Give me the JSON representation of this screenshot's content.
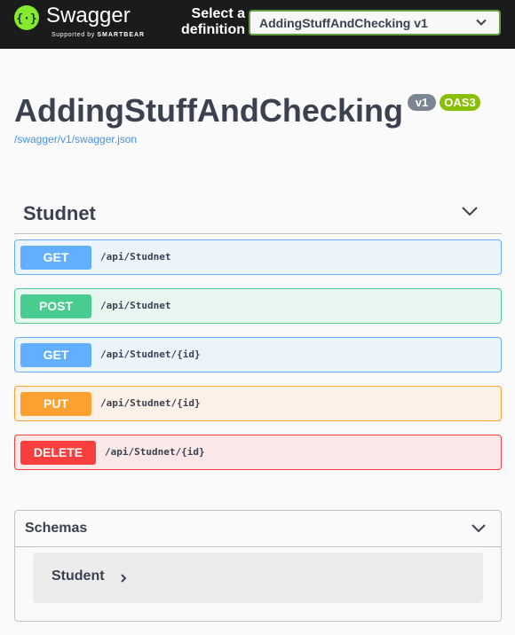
{
  "topbar": {
    "brand": "Swagger",
    "brand_sub_prefix": "Supported by",
    "brand_sub_company": "SMARTBEAR",
    "select_label": "Select a definition",
    "selected_definition": "AddingStuffAndChecking v1",
    "logo_icon": "swagger-logo-icon",
    "chevron_icon": "chevron-down-icon"
  },
  "info": {
    "title": "AddingStuffAndChecking",
    "version": "v1",
    "oas": "OAS3",
    "spec_url": "/swagger/v1/swagger.json"
  },
  "tag": {
    "name": "Studnet",
    "operations": [
      {
        "method": "GET",
        "path": "/api/Studnet"
      },
      {
        "method": "POST",
        "path": "/api/Studnet"
      },
      {
        "method": "GET",
        "path": "/api/Studnet/{id}"
      },
      {
        "method": "PUT",
        "path": "/api/Studnet/{id}"
      },
      {
        "method": "DELETE",
        "path": "/api/Studnet/{id}"
      }
    ]
  },
  "schemas": {
    "title": "Schemas",
    "models": [
      {
        "name": "Student"
      }
    ]
  },
  "colors": {
    "topbar_bg": "#1b1b1b",
    "logo_green": "#85ea2d",
    "get": "#61affe",
    "post": "#49cc90",
    "put": "#fca130",
    "delete": "#f93e3e",
    "link": "#4990e2"
  }
}
